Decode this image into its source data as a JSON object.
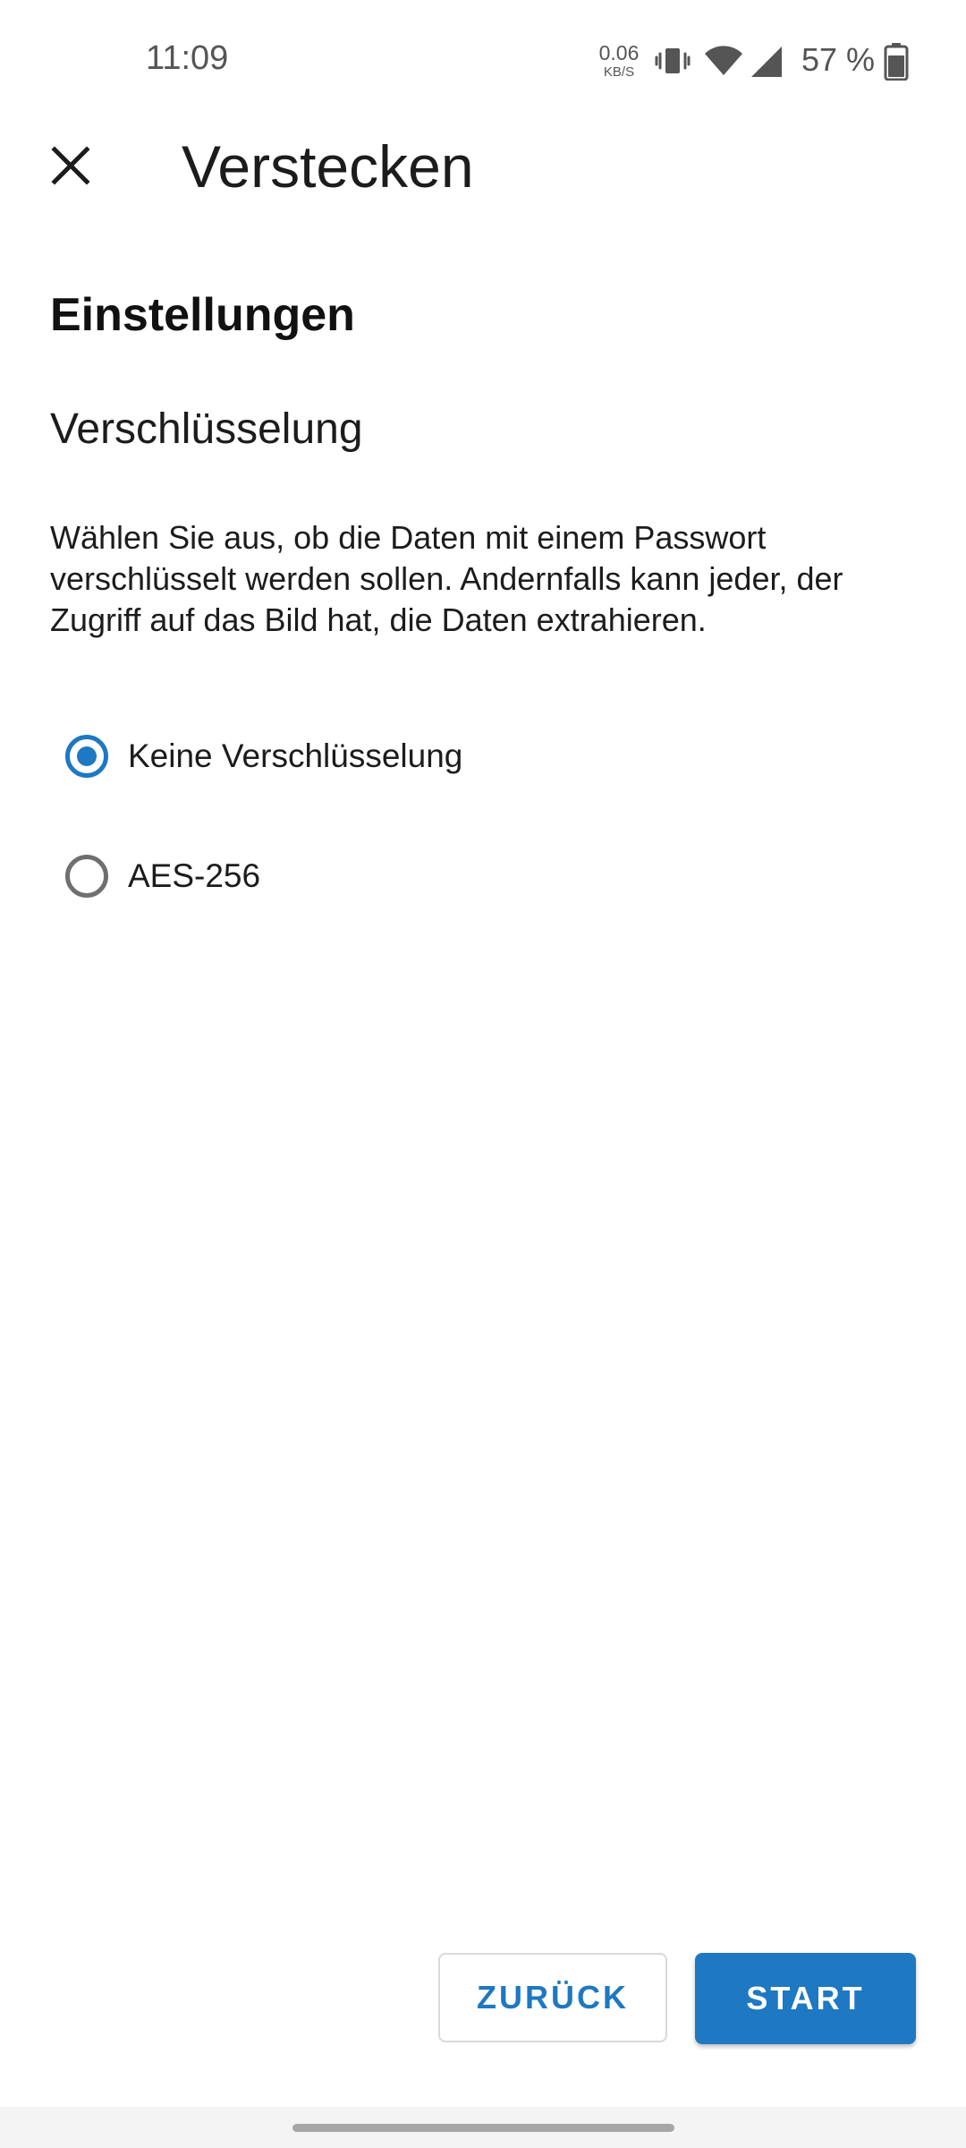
{
  "status_bar": {
    "time": "11:09",
    "net_speed_value": "0.06",
    "net_speed_unit": "KB/S",
    "battery_percent": "57 %",
    "icons": [
      "vibrate-icon",
      "wifi-icon",
      "signal-icon",
      "battery-icon"
    ]
  },
  "app_bar": {
    "close_icon": "close-icon",
    "title": "Verstecken"
  },
  "content": {
    "section_title": "Einstellungen",
    "subtitle": "Verschlüsselung",
    "description": "Wählen Sie aus, ob die Daten mit einem Passwort verschlüsselt werden sollen. Andernfalls kann jeder, der Zugriff auf das Bild hat, die Daten extrahieren.",
    "options": [
      {
        "label": "Keine Verschlüsselung",
        "selected": true
      },
      {
        "label": "AES-256",
        "selected": false
      }
    ]
  },
  "buttons": {
    "back_label": "ZURÜCK",
    "start_label": "START"
  },
  "colors": {
    "accent": "#1e78c2",
    "text": "#1c1c1c",
    "background": "#ffffff"
  }
}
